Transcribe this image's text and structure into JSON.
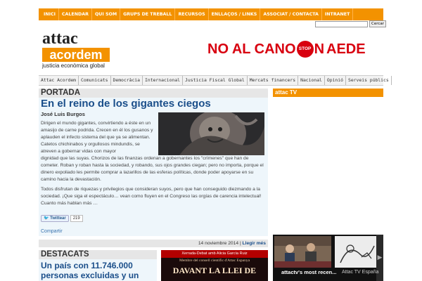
{
  "topnav": {
    "items": [
      "INICI",
      "CALENDAR",
      "QUI SOM",
      "GRUPS DE TREBALL",
      "RECURSOS",
      "ENLLAÇOS / LINKS",
      "ASSOCIAT / CONTACTA",
      "INTRANET"
    ],
    "search_button": "Cercar",
    "accent": "#f39200"
  },
  "logo": {
    "line1": "attac",
    "line2": "acordem",
    "line3": "justicia econòmica global"
  },
  "banner": {
    "part1": "NO  AL  CANO",
    "stop": "STOP",
    "part2": "N",
    "part3": "AEDE"
  },
  "catnav": {
    "items": [
      "Attac Acordem",
      "Comunicats",
      "Democràcia",
      "Internacional",
      "Justicia Fiscal Global",
      "Mercats financers",
      "Nacional",
      "Opinió",
      "Serveis públics"
    ]
  },
  "main": {
    "section": "PORTADA",
    "article": {
      "title": "En el reino de los gigantes ciegos",
      "author": "José Luis Burgos",
      "p1": "Dirigen el mundo gigantes, convirtiendo a éste en un amasijo de carne podrida. Crecen en él los gusanos y aplauden el infecto sistema del que ya se alimentan. Catetos chichinabos y orgullosos mindundis, se atreven a gobernar vidas con mayor",
      "p1b": "dignidad que las suyas. Chorizos de las finanzas ordenan a gobernantes los \"crímenes\" que han de cometer. Roban y roban hasta la sociedad, y robando, sus ojos grandes ciegan; pero no importa, porque el dinero expoliado les permite comprar a lazarillos de las esferas políticas, donde poder apoyarse en su camino hacia la devastación.",
      "p2": "Todos disfrutan de riquezas y privilegios que consideran suyos, pero que han conseguido diezmando a la sociedad. ¡Que siga el espectáculo… vean como fluyen en el Congreso las orgías de carencia intelectual! Cuanto más hablan más …",
      "tweet_label": "Twittear",
      "tweet_count": "219",
      "share": "Compartir",
      "date": "14 noviembre 2014",
      "separator": "|",
      "more": "Llegir més"
    }
  },
  "destacats": {
    "section": "DESTACATS",
    "title": "Un país con 11.746.000 personas excluidas y un 36,3%"
  },
  "promo": {
    "line1": "Xerrada-Debat amb Alicia García Ruiz",
    "line2": "Membre del consell científic d'Attac Espanya",
    "line3": "DAVANT LA LLEI DE"
  },
  "sidebar": {
    "tv_header": "attac TV",
    "video1": "attactv's most recen...",
    "video2": "Attac TV España"
  }
}
